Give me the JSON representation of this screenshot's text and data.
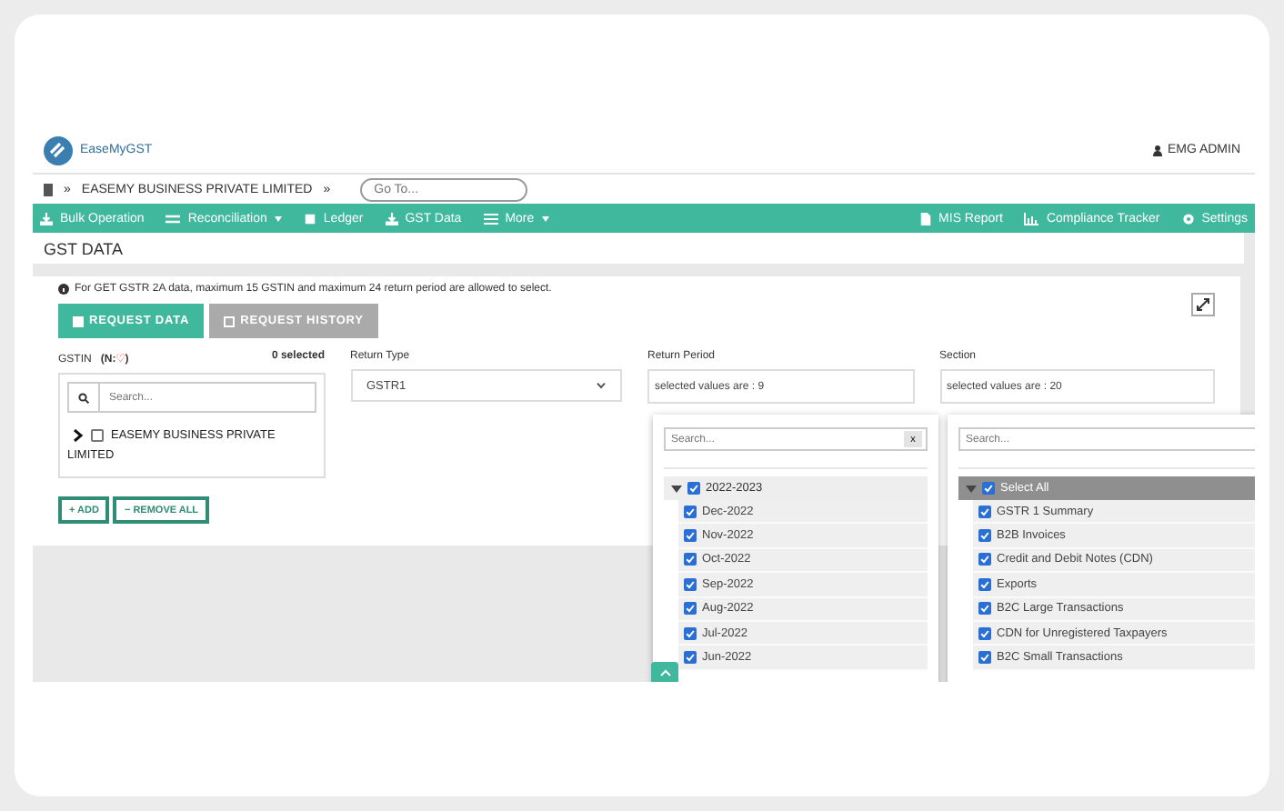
{
  "header": {
    "brand": "EaseMyGST",
    "user": "EMG ADMIN"
  },
  "breadcrumb": {
    "separator": "»",
    "company": "EASEMY BUSINESS PRIVATE LIMITED",
    "goto_placeholder": "Go To..."
  },
  "nav_left": [
    {
      "label": "Bulk Operation",
      "dropdown": false
    },
    {
      "label": "Reconciliation",
      "dropdown": true
    },
    {
      "label": "Ledger",
      "dropdown": false
    },
    {
      "label": "GST Data",
      "dropdown": false
    },
    {
      "label": "More",
      "dropdown": true
    }
  ],
  "nav_right": [
    {
      "label": "MIS Report",
      "dropdown": false
    },
    {
      "label": "Compliance Tracker",
      "dropdown": false
    },
    {
      "label": "Settings",
      "dropdown": false
    }
  ],
  "page_title": "GST DATA",
  "info": "For GET GSTR 2A data, maximum 15 GSTIN and maximum 24 return period are allowed to select.",
  "tabs": [
    {
      "label": "REQUEST DATA",
      "selected": true
    },
    {
      "label": "REQUEST HISTORY",
      "selected": false
    }
  ],
  "gstin": {
    "label": "GSTIN",
    "hint": "(N:",
    "hint_mark": "♡",
    "hint_end": ")",
    "selected_count": "0 selected",
    "search_placeholder": "Search...",
    "items": [
      {
        "label": "EASEMY BUSINESS PRIVATE LIMITED",
        "checked": false
      }
    ]
  },
  "gstin_buttons": [
    "+ ADD",
    "− REMOVE ALL"
  ],
  "return_type": {
    "label": "Return Type",
    "value": "GSTR1"
  },
  "return_period": {
    "label": "Return Period",
    "summary": "selected values are : 9",
    "search_placeholder": "Search...",
    "clear": "x",
    "tree": [
      {
        "label": "2022-2023",
        "checked": true,
        "expanded": true,
        "children": [
          {
            "label": "Dec-2022",
            "checked": true
          },
          {
            "label": "Nov-2022",
            "checked": true
          },
          {
            "label": "Oct-2022",
            "checked": true
          },
          {
            "label": "Sep-2022",
            "checked": true
          },
          {
            "label": "Aug-2022",
            "checked": true
          },
          {
            "label": "Jul-2022",
            "checked": true
          },
          {
            "label": "Jun-2022",
            "checked": true
          }
        ]
      }
    ]
  },
  "section": {
    "label": "Section",
    "summary": "selected values are : 20",
    "search_placeholder": "Search...",
    "tree": [
      {
        "label": "Select All",
        "checked": true,
        "expanded": true,
        "children": [
          {
            "label": "GSTR 1 Summary",
            "checked": true
          },
          {
            "label": "B2B Invoices",
            "checked": true
          },
          {
            "label": "Credit and Debit Notes (CDN)",
            "checked": true
          },
          {
            "label": "Exports",
            "checked": true
          },
          {
            "label": "B2C Large Transactions",
            "checked": true
          },
          {
            "label": "CDN for Unregistered Taxpayers",
            "checked": true
          },
          {
            "label": "B2C Small Transactions",
            "checked": true
          }
        ]
      }
    ]
  }
}
